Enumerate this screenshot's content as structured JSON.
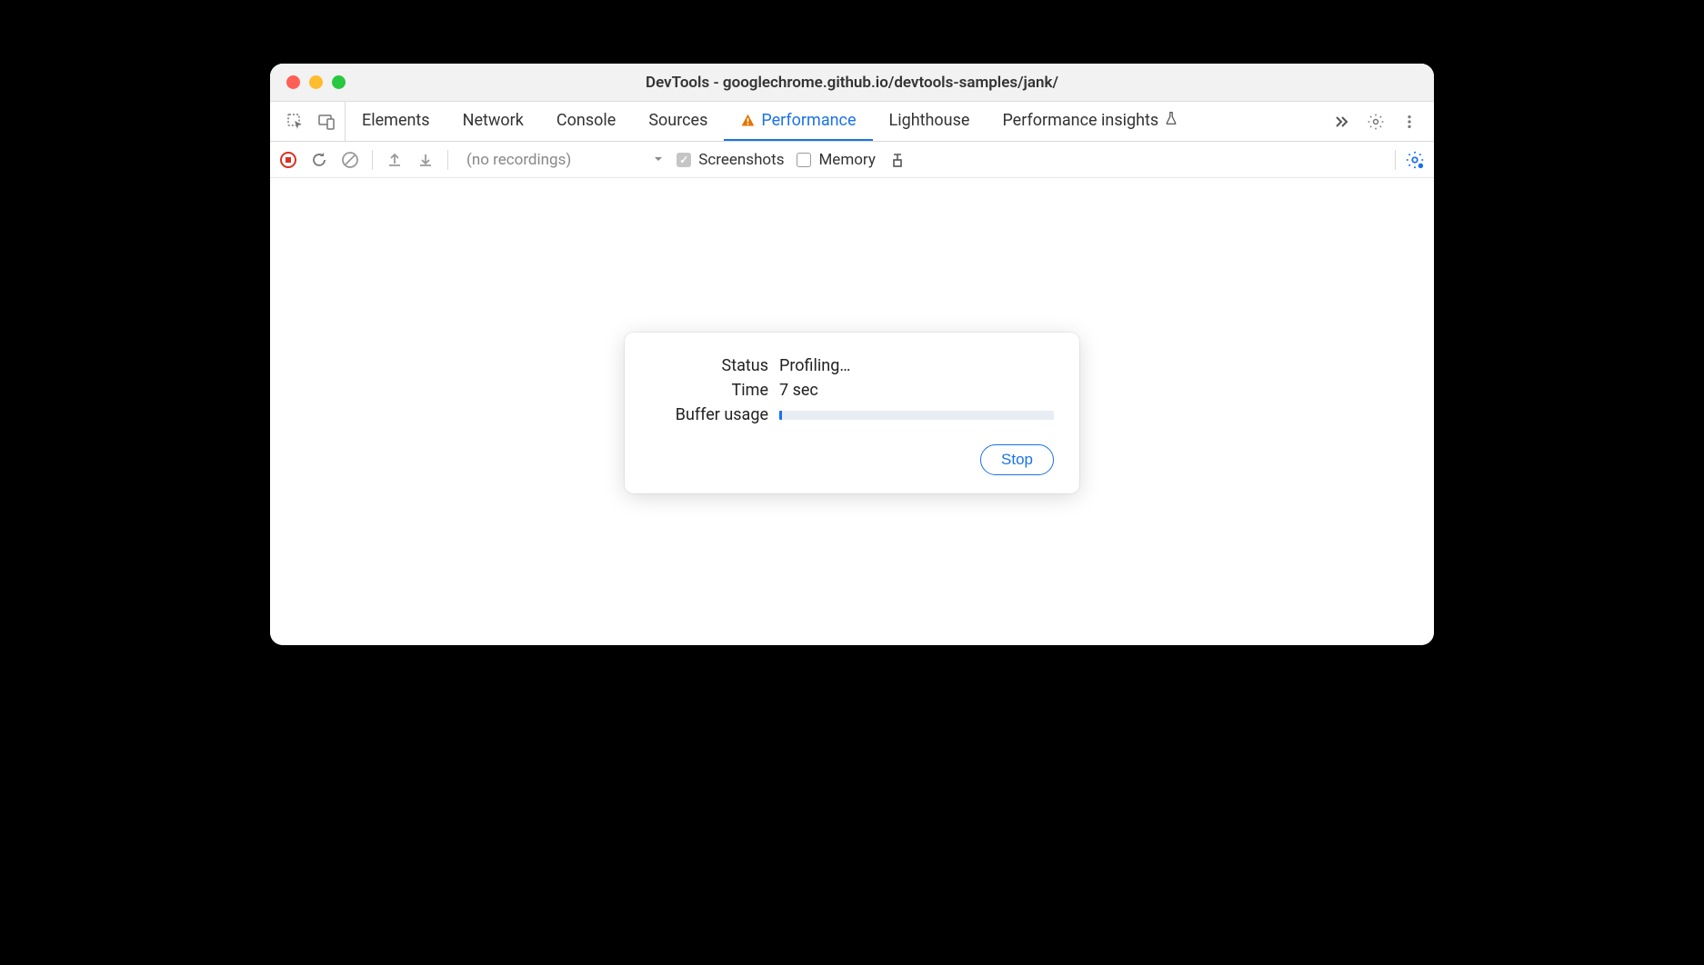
{
  "window": {
    "title": "DevTools - googlechrome.github.io/devtools-samples/jank/"
  },
  "tabs": {
    "elements": "Elements",
    "network": "Network",
    "console": "Console",
    "sources": "Sources",
    "performance": "Performance",
    "lighthouse": "Lighthouse",
    "performance_insights": "Performance insights"
  },
  "toolbar": {
    "recordings_placeholder": "(no recordings)",
    "screenshots_label": "Screenshots",
    "memory_label": "Memory"
  },
  "modal": {
    "status_label": "Status",
    "status_value": "Profiling…",
    "time_label": "Time",
    "time_value": "7 sec",
    "buffer_label": "Buffer usage",
    "buffer_percent": 1,
    "stop_label": "Stop"
  }
}
